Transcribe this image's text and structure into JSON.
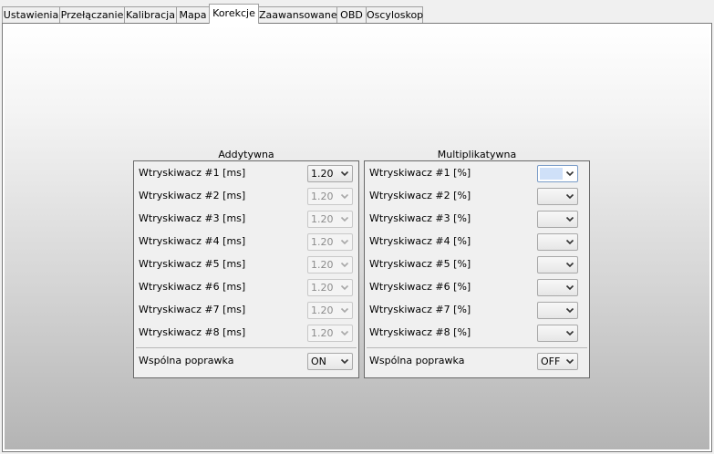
{
  "tabs": [
    {
      "label": "Ustawienia",
      "active": false
    },
    {
      "label": "Przełączanie",
      "active": false
    },
    {
      "label": "Kalibracja",
      "active": false
    },
    {
      "label": "Mapa",
      "active": false
    },
    {
      "label": "Korekcje",
      "active": true
    },
    {
      "label": "Zaawansowane",
      "active": false
    },
    {
      "label": "OBD",
      "active": false
    },
    {
      "label": "Oscyloskop",
      "active": false
    }
  ],
  "additive": {
    "title": "Addytywna",
    "rows": [
      {
        "label": "Wtryskiwacz #1 [ms]",
        "value": "1.20",
        "enabled": true
      },
      {
        "label": "Wtryskiwacz #2 [ms]",
        "value": "1.20",
        "enabled": false
      },
      {
        "label": "Wtryskiwacz #3 [ms]",
        "value": "1.20",
        "enabled": false
      },
      {
        "label": "Wtryskiwacz #4 [ms]",
        "value": "1.20",
        "enabled": false
      },
      {
        "label": "Wtryskiwacz #5 [ms]",
        "value": "1.20",
        "enabled": false
      },
      {
        "label": "Wtryskiwacz #6 [ms]",
        "value": "1.20",
        "enabled": false
      },
      {
        "label": "Wtryskiwacz #7 [ms]",
        "value": "1.20",
        "enabled": false
      },
      {
        "label": "Wtryskiwacz #8 [ms]",
        "value": "1.20",
        "enabled": false
      }
    ],
    "common": {
      "label": "Wspólna poprawka",
      "value": "ON"
    }
  },
  "multiplicative": {
    "title": "Multiplikatywna",
    "rows": [
      {
        "label": "Wtryskiwacz #1 [%]",
        "value": "",
        "enabled": true
      },
      {
        "label": "Wtryskiwacz #2 [%]",
        "value": "",
        "enabled": true
      },
      {
        "label": "Wtryskiwacz #3 [%]",
        "value": "",
        "enabled": true
      },
      {
        "label": "Wtryskiwacz #4 [%]",
        "value": "",
        "enabled": true
      },
      {
        "label": "Wtryskiwacz #5 [%]",
        "value": "",
        "enabled": true
      },
      {
        "label": "Wtryskiwacz #6 [%]",
        "value": "",
        "enabled": true
      },
      {
        "label": "Wtryskiwacz #7 [%]",
        "value": "",
        "enabled": true
      },
      {
        "label": "Wtryskiwacz #8 [%]",
        "value": "",
        "enabled": true
      }
    ],
    "common": {
      "label": "Wspólna poprawka",
      "value": "OFF"
    }
  },
  "icons": {
    "dropdown_arrow": "chevron-down-icon"
  }
}
